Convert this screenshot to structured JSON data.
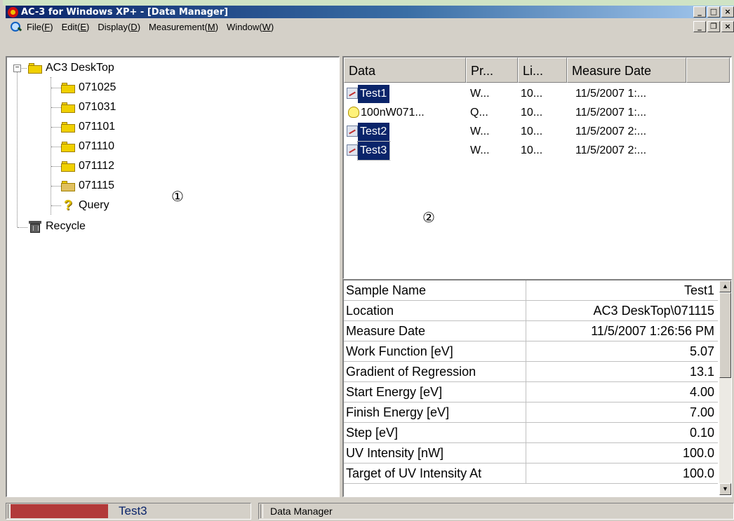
{
  "window": {
    "title": "AC-3 for Windows XP+ - [Data Manager]",
    "minimize": "_",
    "maximize": "□",
    "close": "×"
  },
  "menu": {
    "items": [
      {
        "label": "File(",
        "acc": "F",
        "end": ")"
      },
      {
        "label": "Edit(",
        "acc": "E",
        "end": ")"
      },
      {
        "label": "Display(",
        "acc": "D",
        "end": ")"
      },
      {
        "label": "Measurement(",
        "acc": "M",
        "end": ")"
      },
      {
        "label": "Window(",
        "acc": "W",
        "end": ")"
      }
    ],
    "child_minimize": "_",
    "child_restore": "❐",
    "child_close": "×"
  },
  "tree": {
    "root": "AC3 DeskTop",
    "expander": "−",
    "folders": [
      "071025",
      "071031",
      "071101",
      "071110",
      "071112",
      "071115"
    ],
    "query": "Query",
    "recycle": "Recycle"
  },
  "markers": {
    "left": "①",
    "right": "②"
  },
  "list": {
    "columns": [
      "Data",
      "Pr...",
      "Li...",
      "Measure Date"
    ],
    "rows": [
      {
        "data": "Test1",
        "pr": "W...",
        "li": "10...",
        "date": "11/5/2007 1:...",
        "icon": "graph-icon",
        "selected": true
      },
      {
        "data": "100nW071...",
        "pr": "Q...",
        "li": "10...",
        "date": "11/5/2007 1:...",
        "icon": "bulb-icon",
        "selected": false
      },
      {
        "data": "Test2",
        "pr": "W...",
        "li": "10...",
        "date": "11/5/2007 2:...",
        "icon": "graph-icon",
        "selected": true
      },
      {
        "data": "Test3",
        "pr": "W...",
        "li": "10...",
        "date": "11/5/2007 2:...",
        "icon": "graph-icon",
        "selected": true
      }
    ]
  },
  "properties": {
    "rows": [
      {
        "name": "Sample Name",
        "value": "Test1"
      },
      {
        "name": "Location",
        "value": "AC3 DeskTop\\071115"
      },
      {
        "name": "Measure Date",
        "value": "11/5/2007 1:26:56 PM"
      },
      {
        "name": "Work Function [eV]",
        "value": "5.07"
      },
      {
        "name": "Gradient of Regression",
        "value": "13.1"
      },
      {
        "name": "Start Energy [eV]",
        "value": "4.00"
      },
      {
        "name": "Finish Energy [eV]",
        "value": "7.00"
      },
      {
        "name": "Step [eV]",
        "value": "0.10"
      },
      {
        "name": "UV Intensity [nW]",
        "value": "100.0"
      },
      {
        "name": "Target of UV Intensity At",
        "value": "100.0"
      }
    ],
    "scroll_up": "▲",
    "scroll_down": "▼"
  },
  "status": {
    "progress_label": "Test3",
    "progress_fraction": 0.42,
    "panel": "Data Manager"
  },
  "colors": {
    "selection": "#0a246a",
    "progress": "#b23a3a",
    "folder": "#f0d000"
  }
}
